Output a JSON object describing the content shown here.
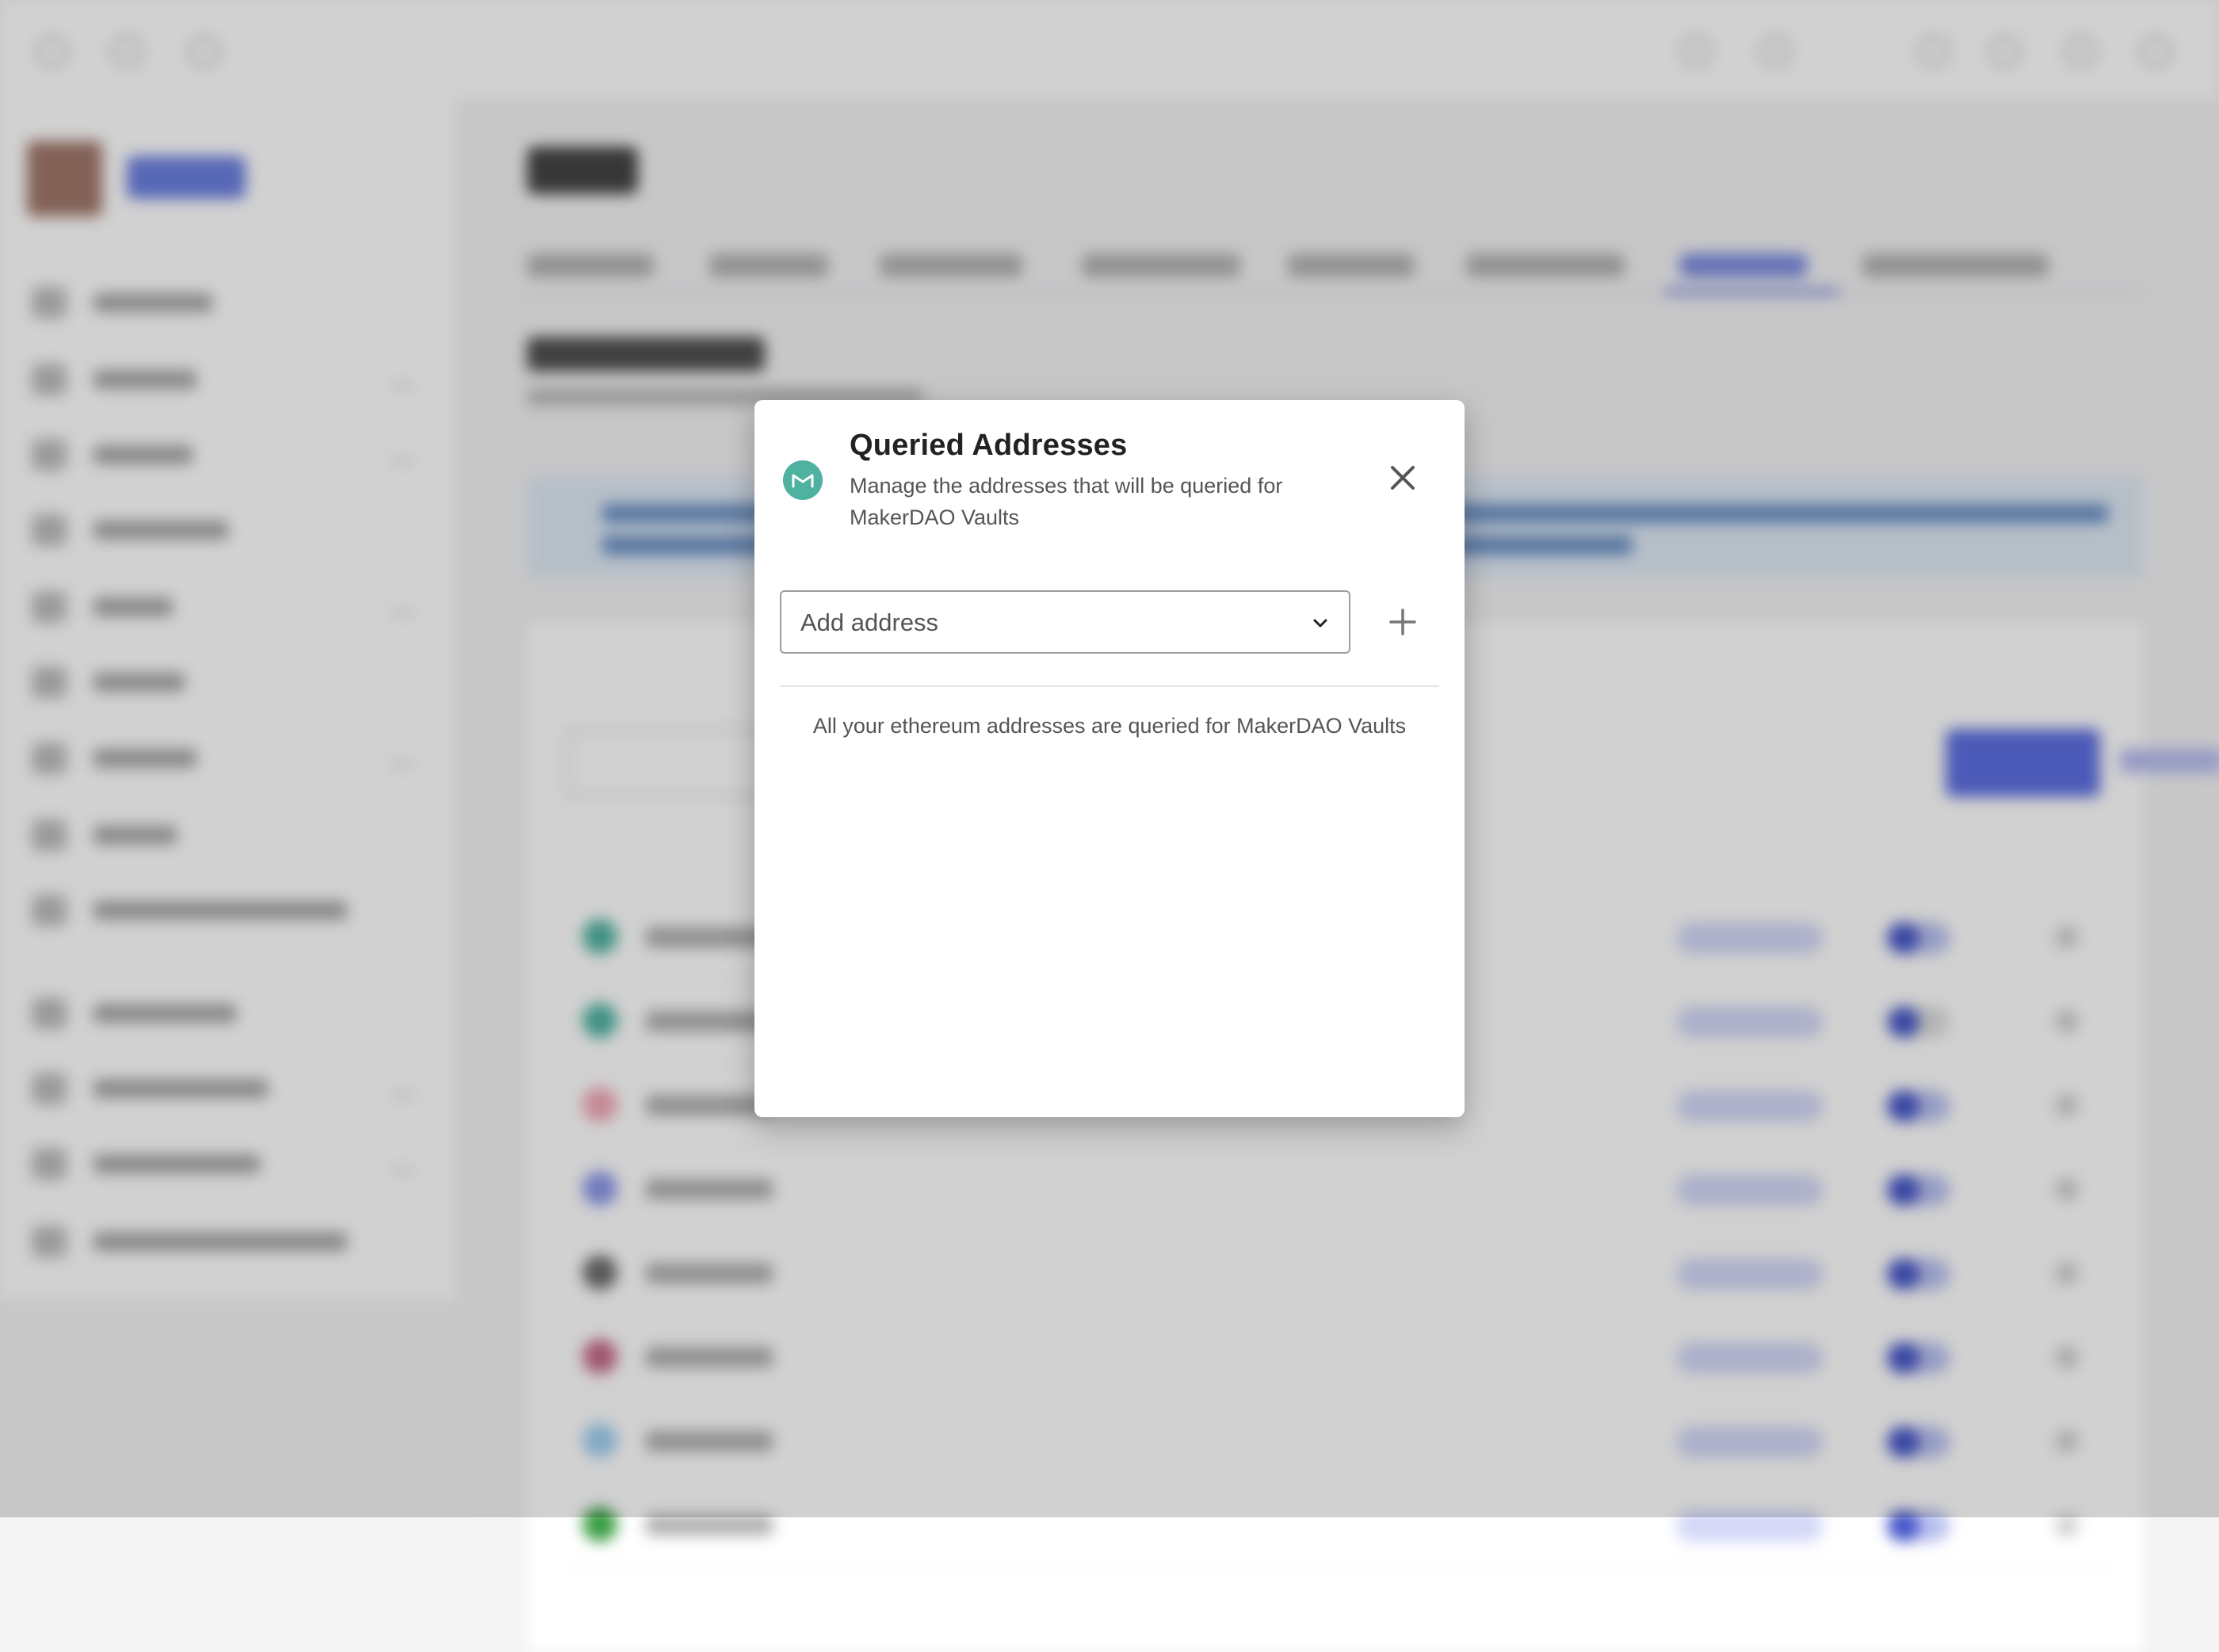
{
  "dialog": {
    "title": "Queried Addresses",
    "subtitle": "Manage the addresses that will be queried for MakerDAO Vaults",
    "logo_icon": "makerdao-icon",
    "close_icon": "close-icon",
    "address_select": {
      "placeholder": "Add address",
      "icon": "chevron-down-icon"
    },
    "add_icon": "plus-icon",
    "empty_message": "All your ethereum addresses are queried for MakerDAO Vaults"
  },
  "colors": {
    "makerdao_logo": "#4fb2a0",
    "accent": "#5d6fe0",
    "scrim": "rgba(0,0,0,0.18)"
  }
}
